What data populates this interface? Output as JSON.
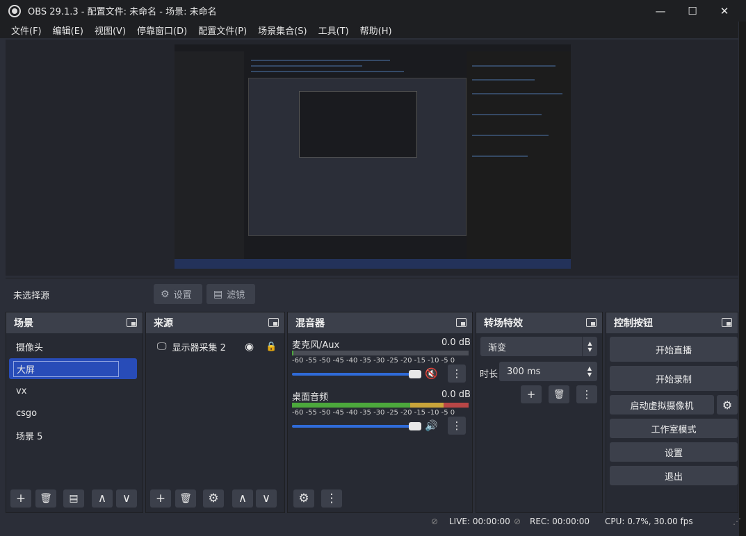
{
  "window": {
    "title": "OBS 29.1.3 - 配置文件: 未命名 - 场景: 未命名",
    "minimize": "—",
    "maximize": "☐",
    "close": "✕"
  },
  "menu": [
    "文件(F)",
    "编辑(E)",
    "视图(V)",
    "停靠窗口(D)",
    "配置文件(P)",
    "场景集合(S)",
    "工具(T)",
    "帮助(H)"
  ],
  "source_bar": {
    "no_selection": "未选择源",
    "settings": "设置",
    "filters": "滤镜"
  },
  "scenes": {
    "title": "场景",
    "items": [
      "摄像头",
      "大屏",
      "vx",
      "csgo",
      "场景 5"
    ],
    "selected_index": 1
  },
  "sources": {
    "title": "来源",
    "items": [
      {
        "name": "显示器采集 2",
        "visible": true,
        "locked": false
      }
    ]
  },
  "mixer": {
    "title": "混音器",
    "ticks": "-60 -55 -50 -45 -40 -35 -30 -25 -20 -15 -10 -5 0",
    "channels": [
      {
        "name": "麦克风/Aux",
        "db": "0.0 dB",
        "muted": true,
        "level": 0.0
      },
      {
        "name": "桌面音频",
        "db": "0.0 dB",
        "muted": false,
        "level": 1.0
      }
    ]
  },
  "transitions": {
    "title": "转场特效",
    "selected": "渐变",
    "duration_label": "时长",
    "duration_value": "300 ms"
  },
  "controls": {
    "title": "控制按钮",
    "start_streaming": "开始直播",
    "start_recording": "开始录制",
    "start_virtual_camera": "启动虚拟摄像机",
    "studio_mode": "工作室模式",
    "settings": "设置",
    "exit": "退出"
  },
  "status": {
    "live": "LIVE: 00:00:00",
    "rec": "REC: 00:00:00",
    "cpu": "CPU: 0.7%, 30.00 fps"
  },
  "icons": {
    "gear": "⚙",
    "plus": "+",
    "trash": "🗑",
    "up": "∧",
    "down": "∨",
    "menu": "⋮",
    "eye": "👁",
    "lock": "🔒",
    "speaker": "🔊",
    "muted": "🔇"
  }
}
